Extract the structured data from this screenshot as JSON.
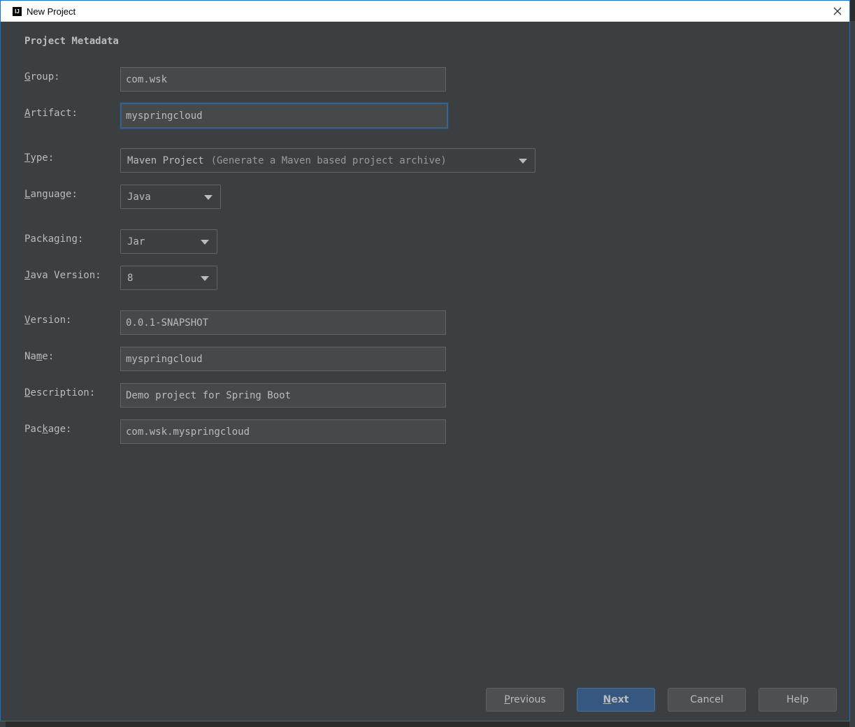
{
  "window": {
    "title": "New Project"
  },
  "section_title": "Project Metadata",
  "fields": {
    "group": {
      "label_u": "G",
      "label_rest": "roup:",
      "value": "com.wsk"
    },
    "artifact": {
      "label_u": "A",
      "label_rest": "rtifact:",
      "value": "myspringcloud"
    },
    "type": {
      "label_u": "T",
      "label_rest": "ype:",
      "value": "Maven Project",
      "hint": "(Generate a Maven based project archive)"
    },
    "language": {
      "label_u": "L",
      "label_rest": "anguage:",
      "value": "Java"
    },
    "packaging": {
      "label_pre": "Packa",
      "label_u": "g",
      "label_rest": "ing:",
      "value": "Jar"
    },
    "java_version": {
      "label_u": "J",
      "label_rest": "ava Version:",
      "value": "8"
    },
    "version": {
      "label_u": "V",
      "label_rest": "ersion:",
      "value": "0.0.1-SNAPSHOT"
    },
    "name": {
      "label_pre": "Na",
      "label_u": "m",
      "label_rest": "e:",
      "value": "myspringcloud"
    },
    "description": {
      "label_u": "D",
      "label_rest": "escription:",
      "value": "Demo project for Spring Boot"
    },
    "package": {
      "label_pre": "Pac",
      "label_u": "k",
      "label_rest": "age:",
      "value": "com.wsk.myspringcloud"
    }
  },
  "buttons": {
    "previous": {
      "u": "P",
      "rest": "revious"
    },
    "next": {
      "u": "N",
      "rest": "ext"
    },
    "cancel": "Cancel",
    "help": "Help"
  }
}
